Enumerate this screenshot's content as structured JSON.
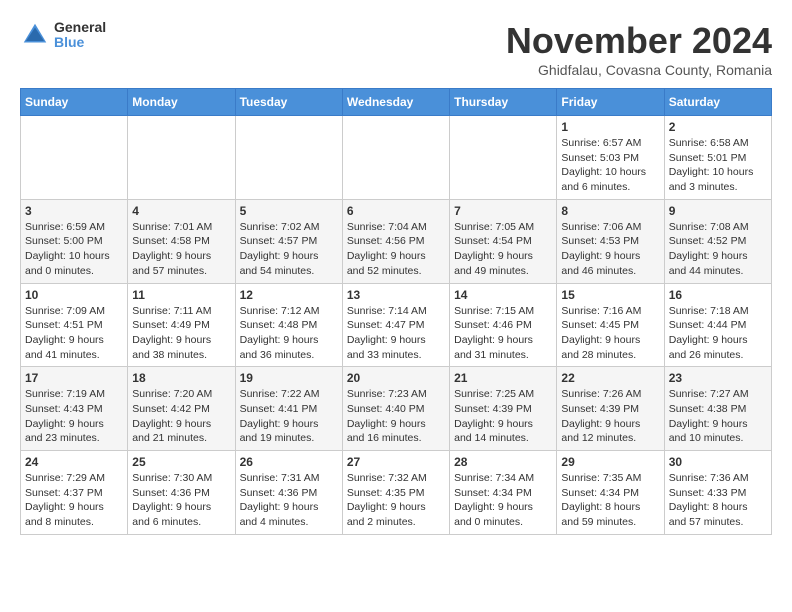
{
  "header": {
    "logo_general": "General",
    "logo_blue": "Blue",
    "month_title": "November 2024",
    "subtitle": "Ghidfalau, Covasna County, Romania"
  },
  "days_of_week": [
    "Sunday",
    "Monday",
    "Tuesday",
    "Wednesday",
    "Thursday",
    "Friday",
    "Saturday"
  ],
  "weeks": [
    [
      {
        "day": "",
        "info": ""
      },
      {
        "day": "",
        "info": ""
      },
      {
        "day": "",
        "info": ""
      },
      {
        "day": "",
        "info": ""
      },
      {
        "day": "",
        "info": ""
      },
      {
        "day": "1",
        "info": "Sunrise: 6:57 AM\nSunset: 5:03 PM\nDaylight: 10 hours and 6 minutes."
      },
      {
        "day": "2",
        "info": "Sunrise: 6:58 AM\nSunset: 5:01 PM\nDaylight: 10 hours and 3 minutes."
      }
    ],
    [
      {
        "day": "3",
        "info": "Sunrise: 6:59 AM\nSunset: 5:00 PM\nDaylight: 10 hours and 0 minutes."
      },
      {
        "day": "4",
        "info": "Sunrise: 7:01 AM\nSunset: 4:58 PM\nDaylight: 9 hours and 57 minutes."
      },
      {
        "day": "5",
        "info": "Sunrise: 7:02 AM\nSunset: 4:57 PM\nDaylight: 9 hours and 54 minutes."
      },
      {
        "day": "6",
        "info": "Sunrise: 7:04 AM\nSunset: 4:56 PM\nDaylight: 9 hours and 52 minutes."
      },
      {
        "day": "7",
        "info": "Sunrise: 7:05 AM\nSunset: 4:54 PM\nDaylight: 9 hours and 49 minutes."
      },
      {
        "day": "8",
        "info": "Sunrise: 7:06 AM\nSunset: 4:53 PM\nDaylight: 9 hours and 46 minutes."
      },
      {
        "day": "9",
        "info": "Sunrise: 7:08 AM\nSunset: 4:52 PM\nDaylight: 9 hours and 44 minutes."
      }
    ],
    [
      {
        "day": "10",
        "info": "Sunrise: 7:09 AM\nSunset: 4:51 PM\nDaylight: 9 hours and 41 minutes."
      },
      {
        "day": "11",
        "info": "Sunrise: 7:11 AM\nSunset: 4:49 PM\nDaylight: 9 hours and 38 minutes."
      },
      {
        "day": "12",
        "info": "Sunrise: 7:12 AM\nSunset: 4:48 PM\nDaylight: 9 hours and 36 minutes."
      },
      {
        "day": "13",
        "info": "Sunrise: 7:14 AM\nSunset: 4:47 PM\nDaylight: 9 hours and 33 minutes."
      },
      {
        "day": "14",
        "info": "Sunrise: 7:15 AM\nSunset: 4:46 PM\nDaylight: 9 hours and 31 minutes."
      },
      {
        "day": "15",
        "info": "Sunrise: 7:16 AM\nSunset: 4:45 PM\nDaylight: 9 hours and 28 minutes."
      },
      {
        "day": "16",
        "info": "Sunrise: 7:18 AM\nSunset: 4:44 PM\nDaylight: 9 hours and 26 minutes."
      }
    ],
    [
      {
        "day": "17",
        "info": "Sunrise: 7:19 AM\nSunset: 4:43 PM\nDaylight: 9 hours and 23 minutes."
      },
      {
        "day": "18",
        "info": "Sunrise: 7:20 AM\nSunset: 4:42 PM\nDaylight: 9 hours and 21 minutes."
      },
      {
        "day": "19",
        "info": "Sunrise: 7:22 AM\nSunset: 4:41 PM\nDaylight: 9 hours and 19 minutes."
      },
      {
        "day": "20",
        "info": "Sunrise: 7:23 AM\nSunset: 4:40 PM\nDaylight: 9 hours and 16 minutes."
      },
      {
        "day": "21",
        "info": "Sunrise: 7:25 AM\nSunset: 4:39 PM\nDaylight: 9 hours and 14 minutes."
      },
      {
        "day": "22",
        "info": "Sunrise: 7:26 AM\nSunset: 4:39 PM\nDaylight: 9 hours and 12 minutes."
      },
      {
        "day": "23",
        "info": "Sunrise: 7:27 AM\nSunset: 4:38 PM\nDaylight: 9 hours and 10 minutes."
      }
    ],
    [
      {
        "day": "24",
        "info": "Sunrise: 7:29 AM\nSunset: 4:37 PM\nDaylight: 9 hours and 8 minutes."
      },
      {
        "day": "25",
        "info": "Sunrise: 7:30 AM\nSunset: 4:36 PM\nDaylight: 9 hours and 6 minutes."
      },
      {
        "day": "26",
        "info": "Sunrise: 7:31 AM\nSunset: 4:36 PM\nDaylight: 9 hours and 4 minutes."
      },
      {
        "day": "27",
        "info": "Sunrise: 7:32 AM\nSunset: 4:35 PM\nDaylight: 9 hours and 2 minutes."
      },
      {
        "day": "28",
        "info": "Sunrise: 7:34 AM\nSunset: 4:34 PM\nDaylight: 9 hours and 0 minutes."
      },
      {
        "day": "29",
        "info": "Sunrise: 7:35 AM\nSunset: 4:34 PM\nDaylight: 8 hours and 59 minutes."
      },
      {
        "day": "30",
        "info": "Sunrise: 7:36 AM\nSunset: 4:33 PM\nDaylight: 8 hours and 57 minutes."
      }
    ]
  ]
}
